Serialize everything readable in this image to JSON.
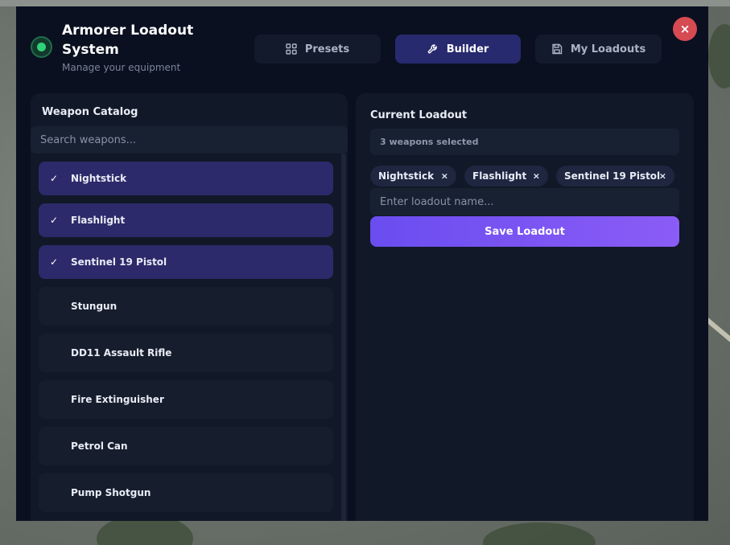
{
  "header": {
    "title": "Armorer Loadout System",
    "subtitle": "Manage your equipment",
    "close_label": "×"
  },
  "tabs": [
    {
      "label": "Presets",
      "icon": "grid-icon",
      "active": false
    },
    {
      "label": "Builder",
      "icon": "wrench-icon",
      "active": true
    },
    {
      "label": "My Loadouts",
      "icon": "save-icon",
      "active": false
    }
  ],
  "catalog": {
    "title": "Weapon Catalog",
    "search_placeholder": "Search weapons...",
    "items": [
      {
        "label": "Nightstick",
        "selected": true
      },
      {
        "label": "Flashlight",
        "selected": true
      },
      {
        "label": "Sentinel 19 Pistol",
        "selected": true
      },
      {
        "label": "Stungun",
        "selected": false
      },
      {
        "label": "DD11 Assault Rifle",
        "selected": false
      },
      {
        "label": "Fire Extinguisher",
        "selected": false
      },
      {
        "label": "Petrol Can",
        "selected": false
      },
      {
        "label": "Pump Shotgun",
        "selected": false
      }
    ]
  },
  "loadout": {
    "title": "Current Loadout",
    "count_text": "3 weapons selected",
    "chips": [
      {
        "label": "Nightstick"
      },
      {
        "label": "Flashlight"
      },
      {
        "label": "Sentinel 19 Pistol"
      }
    ],
    "chip_remove": "×",
    "name_placeholder": "Enter loadout name...",
    "save_label": "Save Loadout"
  },
  "colors": {
    "accent": "#6a4df0",
    "status": "#2fd17a",
    "close": "#d64a52",
    "selected_row": "#2c2a6a"
  }
}
